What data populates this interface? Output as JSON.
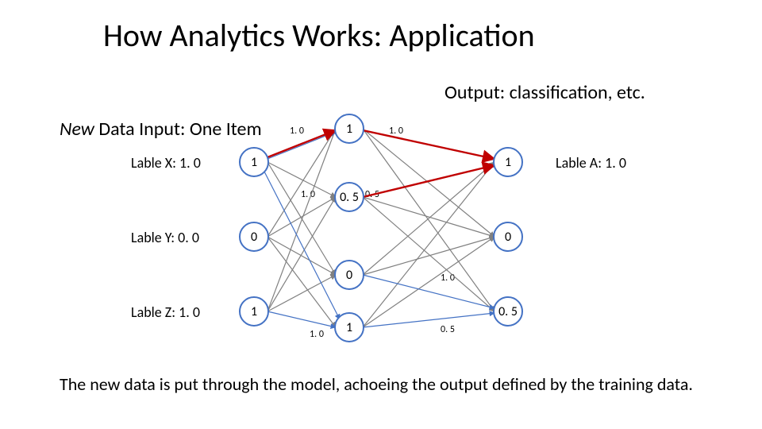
{
  "title": "How Analytics Works: Application",
  "output_label": "Output: classification, etc.",
  "input_prefix_italic": "New",
  "input_rest": " Data Input: One Item",
  "footer": "The new data is put through the model, achoeing the output defined by the training data.",
  "left_labels": {
    "x": "Lable X: 1. 0",
    "y": "Lable Y: 0. 0",
    "z": "Lable Z: 1. 0"
  },
  "right_labels": {
    "a": "Lable A: 1. 0"
  },
  "nodes": {
    "in_x": "1",
    "in_y": "0",
    "in_z": "1",
    "h1": "1",
    "h2": "0. 5",
    "h3": "0",
    "h4": "1",
    "out_a": "1",
    "out_b": "0",
    "out_c": "0. 5"
  },
  "weights": {
    "x_h1": "1. 0",
    "x_h4": "1. 0",
    "h1_a": "1. 0",
    "h2_a": "0. 5",
    "h3_c": "1. 0",
    "h4_c": "0. 5"
  },
  "colors": {
    "node_stroke": "#4472C4",
    "edge_blue": "#4472C4",
    "edge_red": "#C00000",
    "edge_gray": "#808080"
  }
}
